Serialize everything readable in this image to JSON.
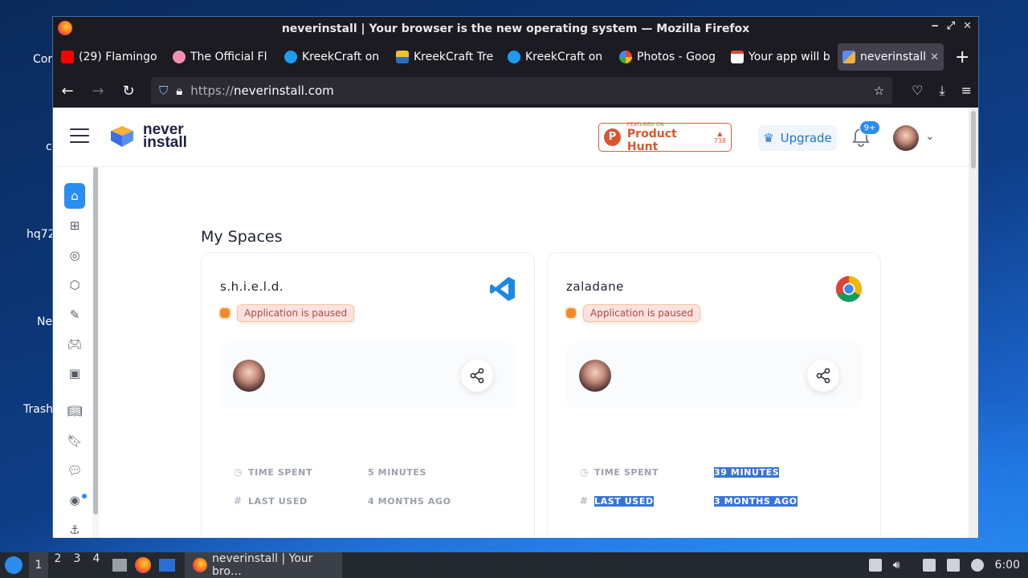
{
  "desktop": {
    "icons": [
      {
        "label": "Cor"
      },
      {
        "label": "c"
      },
      {
        "label": "hq72"
      },
      {
        "label": "Ne"
      },
      {
        "label": "Trash"
      }
    ]
  },
  "window": {
    "title": "neverinstall | Your browser is the new operating system — Mozilla Firefox",
    "controls": {
      "minimize": "‒",
      "maximize": "⤢",
      "close": "✕"
    }
  },
  "tabs": [
    {
      "label": "(29) Flamingo",
      "icon": "youtube-icon",
      "color": "#ff0000"
    },
    {
      "label": "The Official Fl",
      "icon": "flamingo-icon",
      "color": "#f48fb1"
    },
    {
      "label": "KreekCraft on",
      "icon": "twitter-icon",
      "color": "#1d9bf0"
    },
    {
      "label": "KreekCraft Tre",
      "icon": "trello-icon",
      "color": "#2c6fb7"
    },
    {
      "label": "KreekCraft on",
      "icon": "twitter-icon",
      "color": "#1d9bf0"
    },
    {
      "label": "Photos - Goog",
      "icon": "photos-icon",
      "color": "#fbbc05"
    },
    {
      "label": "Your app will b",
      "icon": "gmail-icon",
      "color": "#ea4335"
    },
    {
      "label": "neverinstall",
      "icon": "neverinstall-icon",
      "color": "#2a8df0",
      "active": true
    }
  ],
  "navbar": {
    "url_protocol": "https://",
    "url_host": "neverinstall.com"
  },
  "app": {
    "logo_line1": "never",
    "logo_line2": "install",
    "producthunt": {
      "small": "FEATURED ON",
      "big": "Product Hunt",
      "votes": "738",
      "arrow": "▲"
    },
    "upgrade_label": "Upgrade",
    "notif_badge": "9+",
    "section_title": "My Spaces"
  },
  "spaces": [
    {
      "name": "s.h.i.e.l.d.",
      "app_icon": "vscode-icon",
      "status": "Application is paused",
      "time_spent_label": "TIME SPENT",
      "time_spent": "5 MINUTES",
      "last_used_label": "LAST USED",
      "last_used": "4 MONTHS AGO"
    },
    {
      "name": "zaladane",
      "app_icon": "chrome-icon",
      "status": "Application is paused",
      "time_spent_label": "TIME SPENT",
      "time_spent": "39 MINUTES",
      "last_used_label": "LAST USED",
      "last_used": "3 MONTHS AGO"
    }
  ],
  "taskbar": {
    "workspaces": [
      "1",
      "2",
      "3",
      "4"
    ],
    "app_label": "neverinstall | Your bro…",
    "clock": "6:00"
  }
}
